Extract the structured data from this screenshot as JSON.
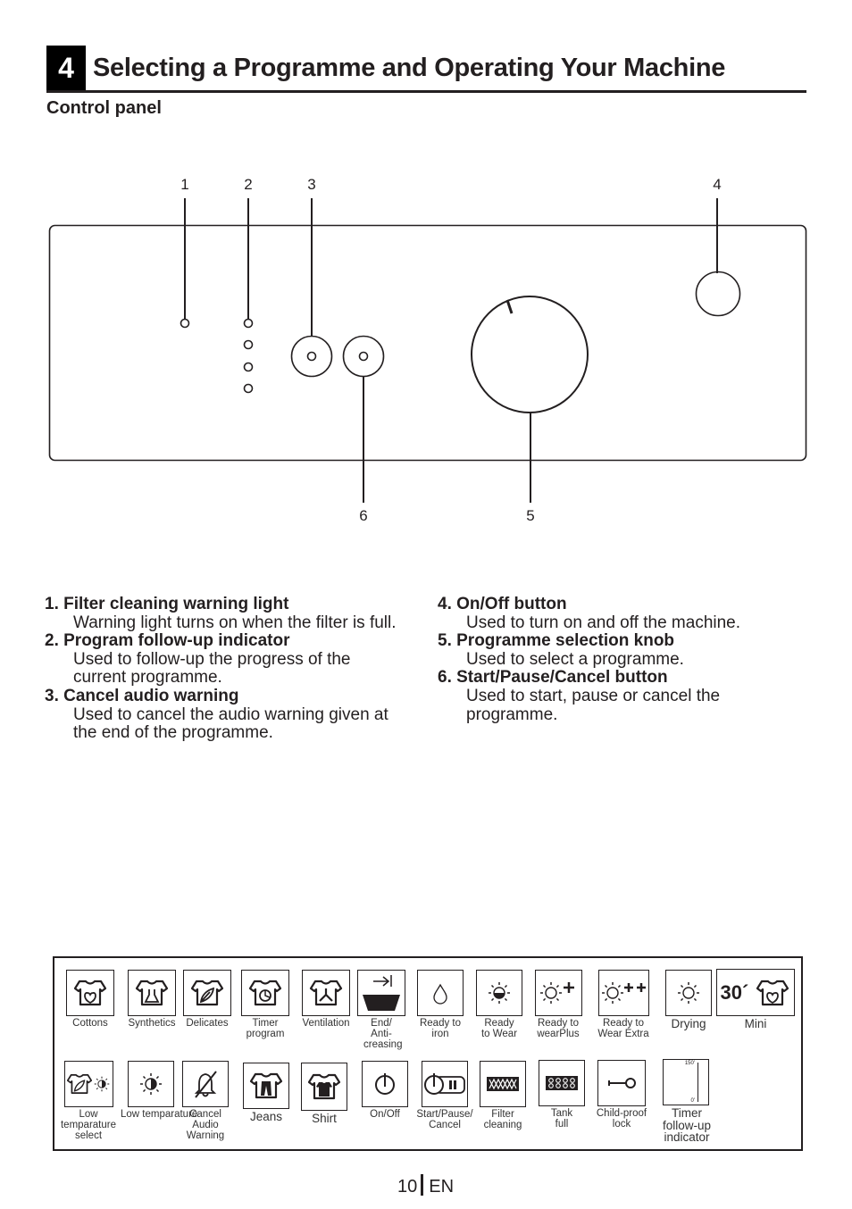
{
  "header": {
    "section_number": "4",
    "title": "Selecting a Programme and Operating Your Machine",
    "subtitle": "Control panel"
  },
  "diagram": {
    "callouts": [
      "1",
      "2",
      "3",
      "4",
      "5",
      "6"
    ],
    "program_followup_led_count": 4
  },
  "descriptions": {
    "left": [
      {
        "title": "1. Filter cleaning warning light",
        "body": "Warning light turns on when the filter is full."
      },
      {
        "title": "2. Program follow-up indicator",
        "body": "Used to follow-up the progress of the current programme."
      },
      {
        "title": "3. Cancel audio warning",
        "body": "Used to cancel the audio warning given at the end of the programme."
      }
    ],
    "right": [
      {
        "title": "4. On/Off button",
        "body": "Used to turn on and off the machine."
      },
      {
        "title": "5. Programme selection knob",
        "body": "Used to select a programme."
      },
      {
        "title": "6. Start/Pause/Cancel button",
        "body": "Used to start, pause or cancel the programme."
      }
    ]
  },
  "legend": {
    "row1": [
      {
        "icon": "cottons-shirt-icon",
        "label": "Cottons"
      },
      {
        "icon": "synthetics-shirt-icon",
        "label": "Synthetics"
      },
      {
        "icon": "delicates-shirt-icon",
        "label": "Delicates"
      },
      {
        "icon": "timer-shirt-icon",
        "label": "Timer program"
      },
      {
        "icon": "ventilation-shirt-icon",
        "label": "Ventilation"
      },
      {
        "icon": "end-anticreasing-icon",
        "label": "End/ Anti- creasing"
      },
      {
        "icon": "water-drop-icon",
        "label": "Ready to iron"
      },
      {
        "icon": "half-sun-icon",
        "label": "Ready to Wear"
      },
      {
        "icon": "sun-plus-icon",
        "label": "Ready to wearPlus"
      },
      {
        "icon": "sun-plus-plus-icon",
        "label": "Ready to Wear Extra"
      },
      {
        "icon": "sun-icon",
        "label": "Drying"
      },
      {
        "icon": "mini-30-shirt-icon",
        "label": "Mini",
        "badge": "30´"
      }
    ],
    "row2": [
      {
        "icon": "delicate-shirt-half-sun-icon",
        "label": "Low temparature select"
      },
      {
        "icon": "half-sun-icon",
        "label": "Low temparature"
      },
      {
        "icon": "bell-crossed-icon",
        "label": "Cancel Audio Warning"
      },
      {
        "icon": "jeans-shirt-icon",
        "label": "Jeans"
      },
      {
        "icon": "shirt-filled-icon",
        "label": "Shirt"
      },
      {
        "icon": "power-icon",
        "label": "On/Off"
      },
      {
        "icon": "power-pause-icon",
        "label": "Start/Pause/ Cancel"
      },
      {
        "icon": "filter-mesh-icon",
        "label": "Filter cleaning"
      },
      {
        "icon": "tank-grid-icon",
        "label": "Tank full"
      },
      {
        "icon": "key-icon",
        "label": "Child-proof lock"
      },
      {
        "icon": "timer-scale-icon",
        "label": "Timer follow-up indicator",
        "scale_top": "150'",
        "scale_bottom": "0'"
      }
    ]
  },
  "footer": {
    "page_number": "10",
    "language": "EN"
  }
}
